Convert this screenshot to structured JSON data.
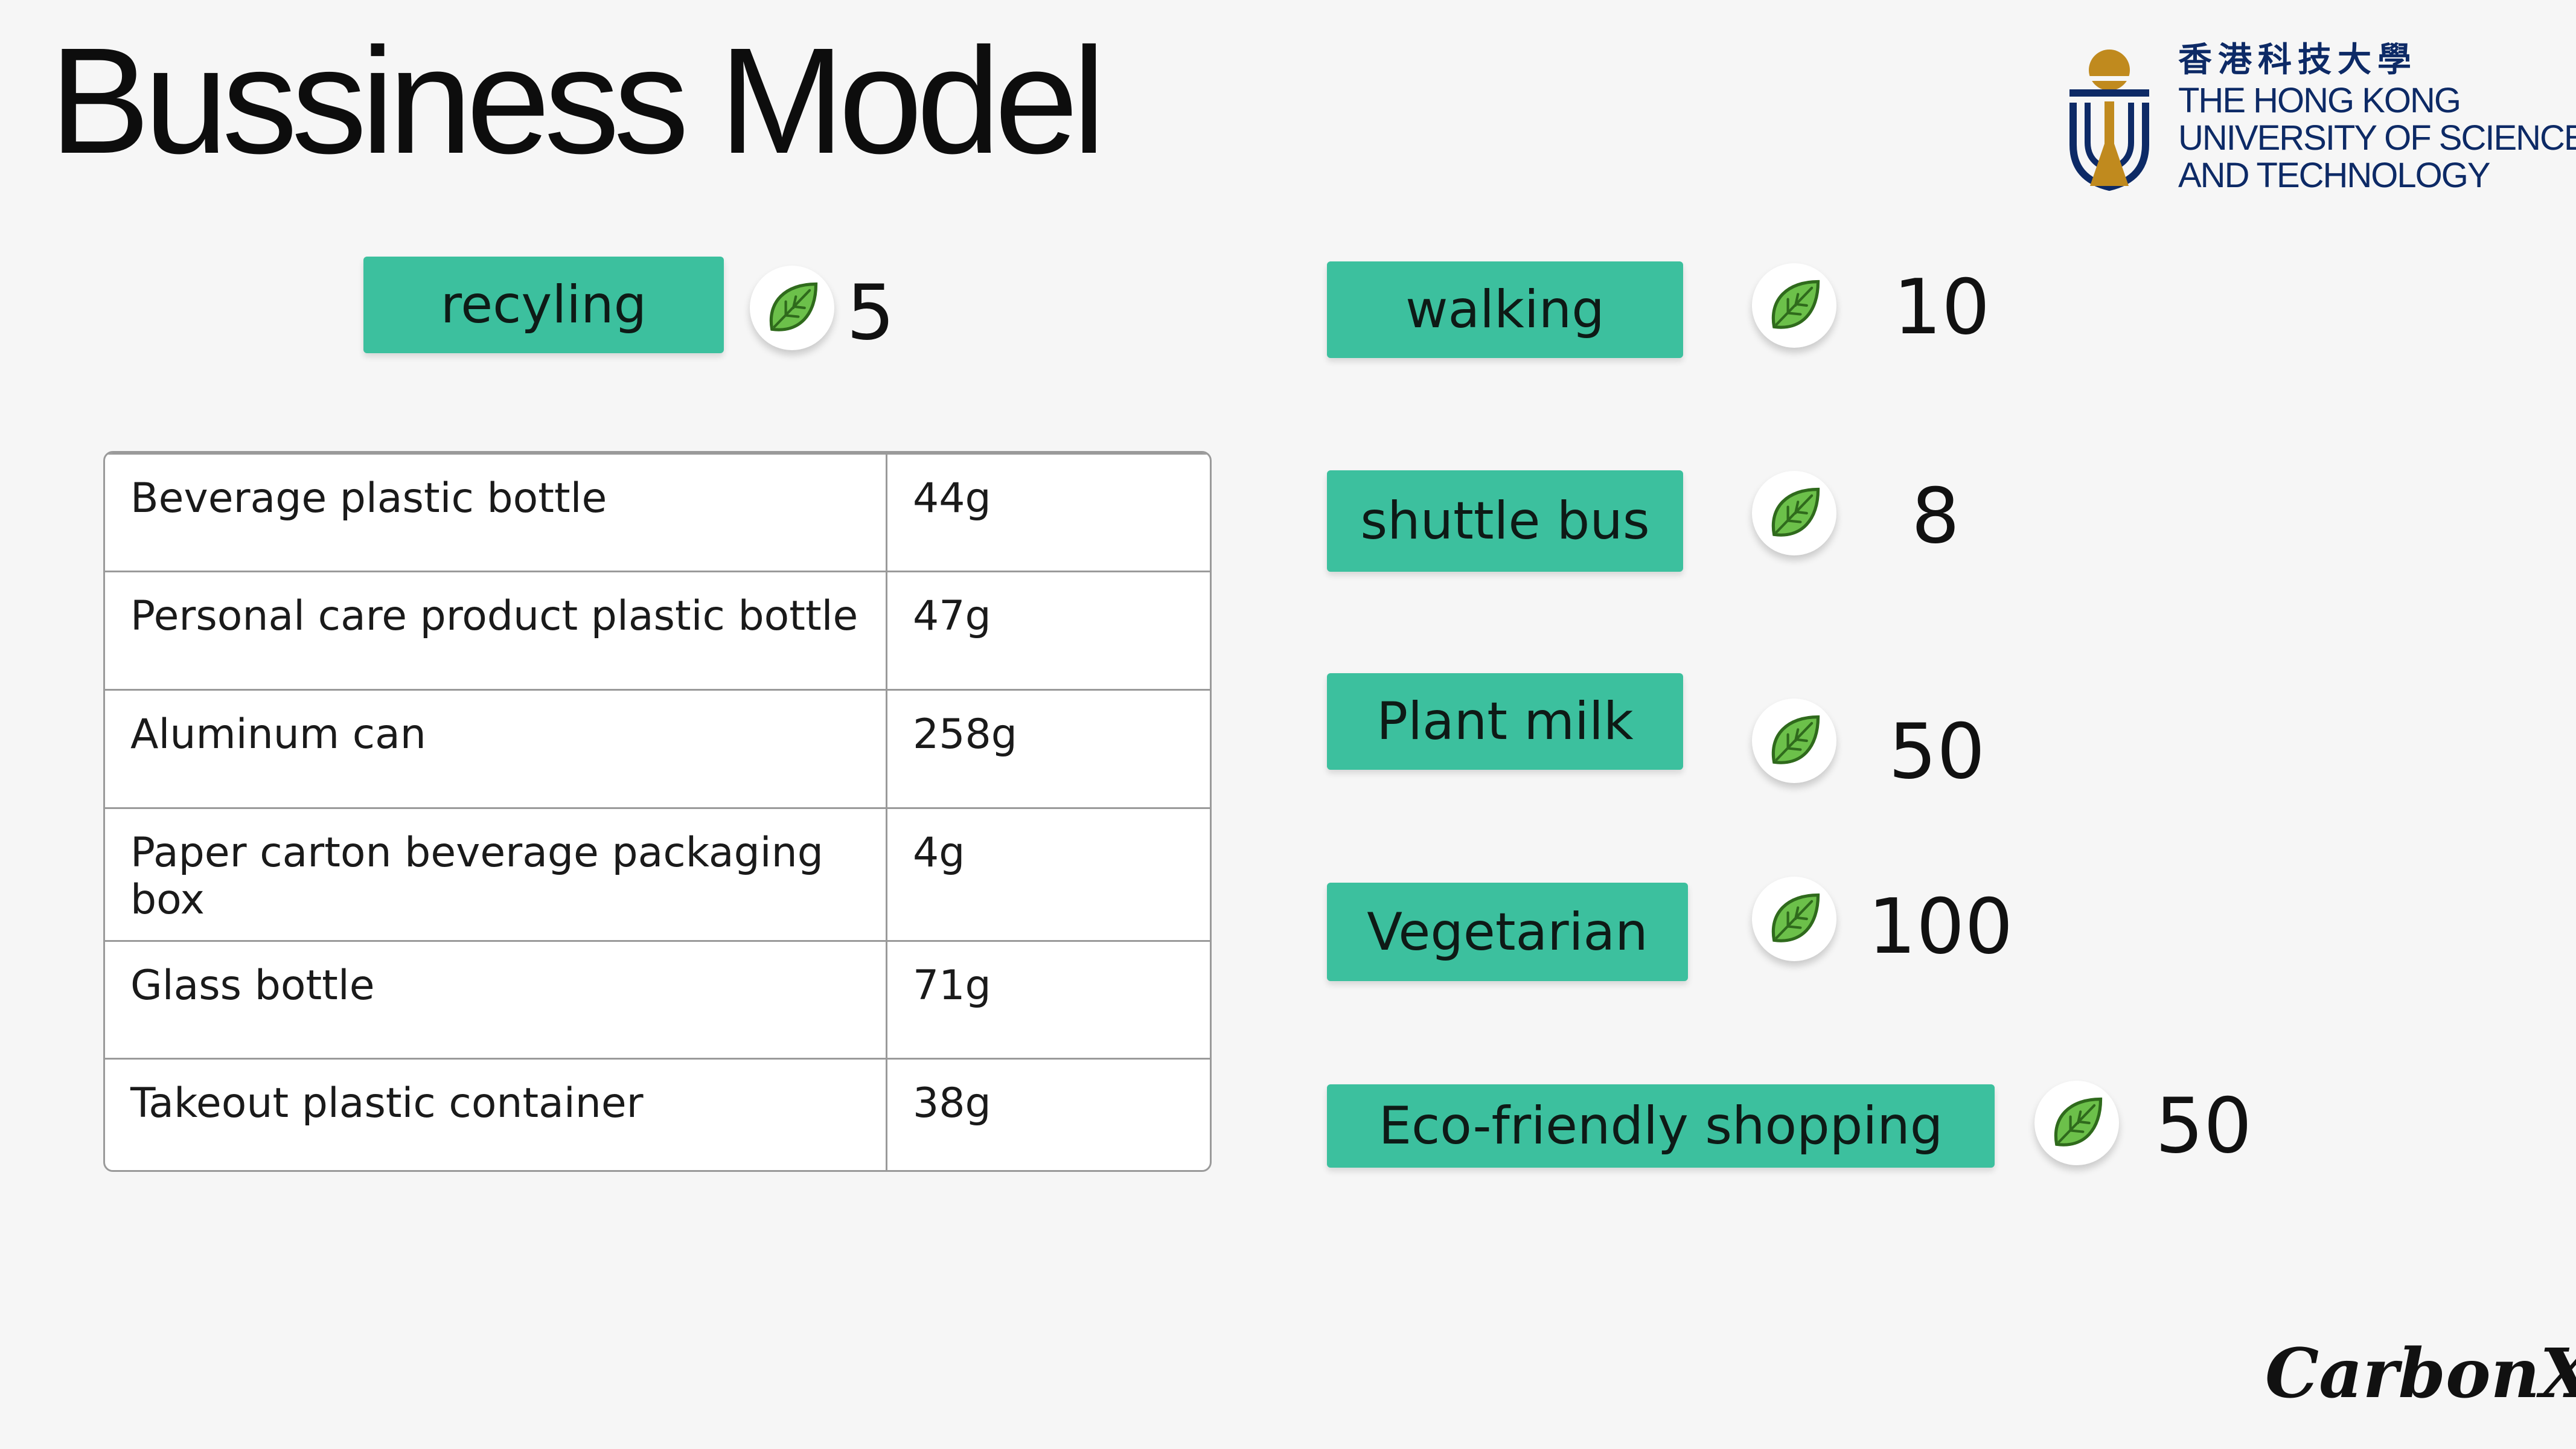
{
  "title": "Bussiness Model",
  "logo": {
    "chinese": "香港科技大學",
    "english_line1": "THE HONG KONG",
    "english_line2": "UNIVERSITY OF SCIENCE",
    "english_line3": "AND TECHNOLOGY"
  },
  "recycling": {
    "label": "recyling",
    "points": "5"
  },
  "items_table": {
    "rows": [
      {
        "name": "Beverage plastic bottle",
        "weight": "44g"
      },
      {
        "name": "Personal care product plastic bottle",
        "weight": "47g"
      },
      {
        "name": "Aluminum can",
        "weight": "258g"
      },
      {
        "name": "Paper carton beverage packaging box",
        "weight": "4g"
      },
      {
        "name": "Glass bottle",
        "weight": "71g"
      },
      {
        "name": "Takeout plastic container",
        "weight": "38g"
      }
    ]
  },
  "activities": [
    {
      "label": "walking",
      "points": "10"
    },
    {
      "label": "shuttle bus",
      "points": "8"
    },
    {
      "label": "Plant milk",
      "points": "50"
    },
    {
      "label": "Vegetarian",
      "points": "100"
    },
    {
      "label": "Eco-friendly shopping",
      "points": "50"
    }
  ],
  "brand": "CarbonX",
  "icons": {
    "leaf": "leaf-icon"
  },
  "colors": {
    "pill": "#3cc09e",
    "leaf": "#6cc04a",
    "logo_blue": "#0d2a66",
    "logo_gold": "#c08a1e"
  }
}
